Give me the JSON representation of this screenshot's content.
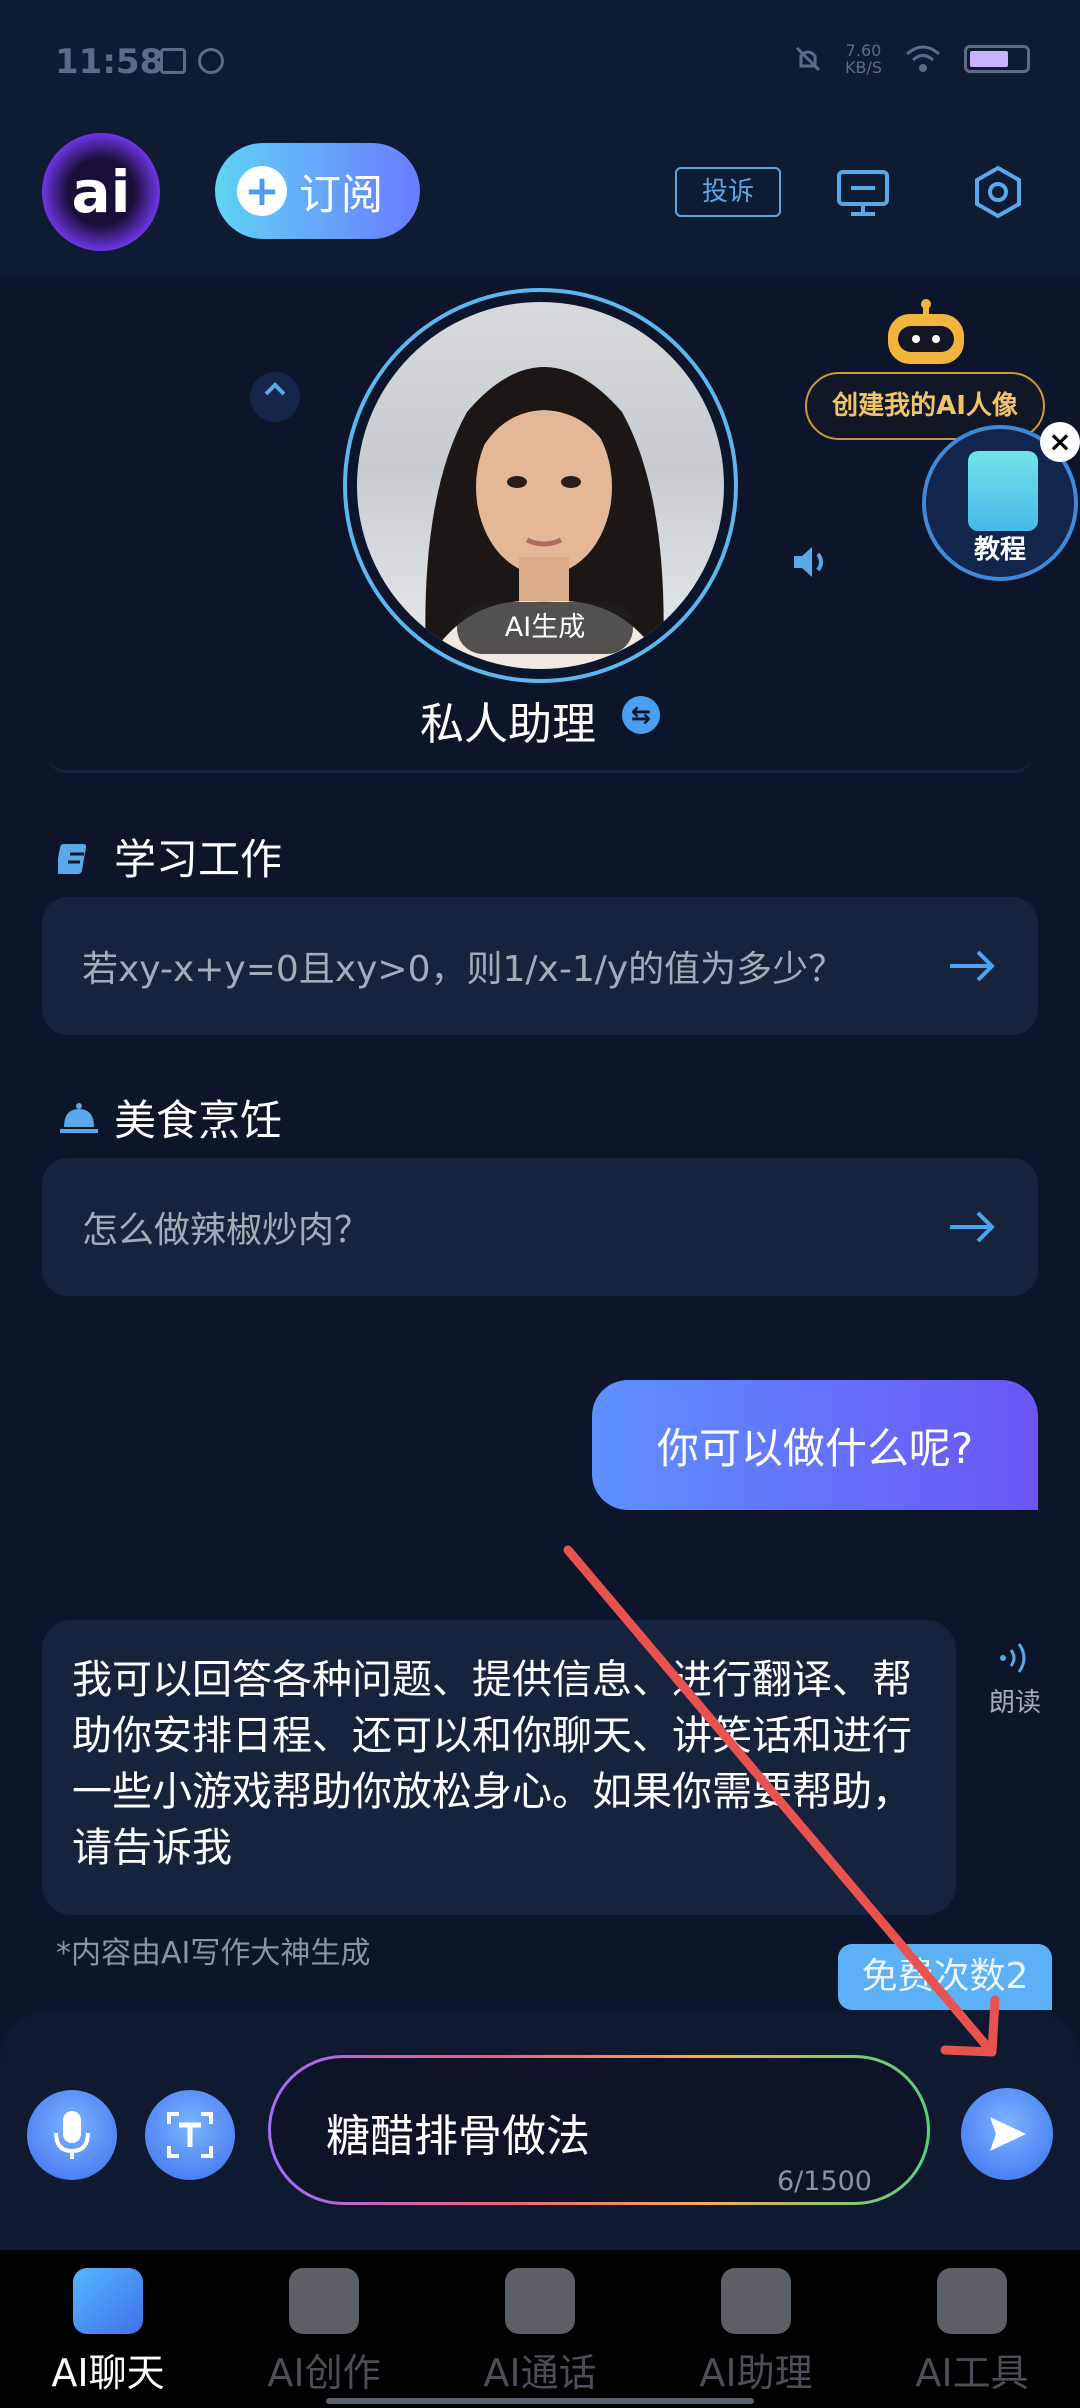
{
  "status_bar": {
    "time": "11:58",
    "net_speed": "7.60",
    "net_unit": "KB/S",
    "battery_level": 0.7
  },
  "header": {
    "logo_text": "ai",
    "subscribe_label": "订阅",
    "complaint_label": "投诉"
  },
  "assistant": {
    "ai_badge": "AI生成",
    "name": "私人助理",
    "create_label": "创建我的AI人像",
    "tutorial_label": "教程"
  },
  "suggestions": [
    {
      "category": "学习工作",
      "prompt": "若xy-x+y=0且xy>0，则1/x-1/y的值为多少？"
    },
    {
      "category": "美食烹饪",
      "prompt": "怎么做辣椒炒肉？"
    }
  ],
  "chat": {
    "user_message": "你可以做什么呢?",
    "ai_message": "我可以回答各种问题、提供信息、进行翻译、帮助你安排日程、还可以和你聊天、讲笑话和进行一些小游戏帮助你放松身心。如果你需要帮助，请告诉我",
    "read_label": "朗读",
    "disclaimer": "*内容由AI写作大神生成",
    "free_count": "免费次数2"
  },
  "input": {
    "text": "糖醋排骨做法",
    "char_count": "6/1500"
  },
  "nav": [
    {
      "label": "AI聊天",
      "active": true
    },
    {
      "label": "AI创作",
      "active": false
    },
    {
      "label": "AI通话",
      "active": false
    },
    {
      "label": "AI助理",
      "active": false
    },
    {
      "label": "AI工具",
      "active": false
    }
  ],
  "colors": {
    "accent": "#5aa8e8",
    "bubble_start": "#5e91ff",
    "bubble_end": "#6b55f5",
    "free_badge": "#5cb0f5",
    "annotation_arrow": "#e8524f"
  }
}
